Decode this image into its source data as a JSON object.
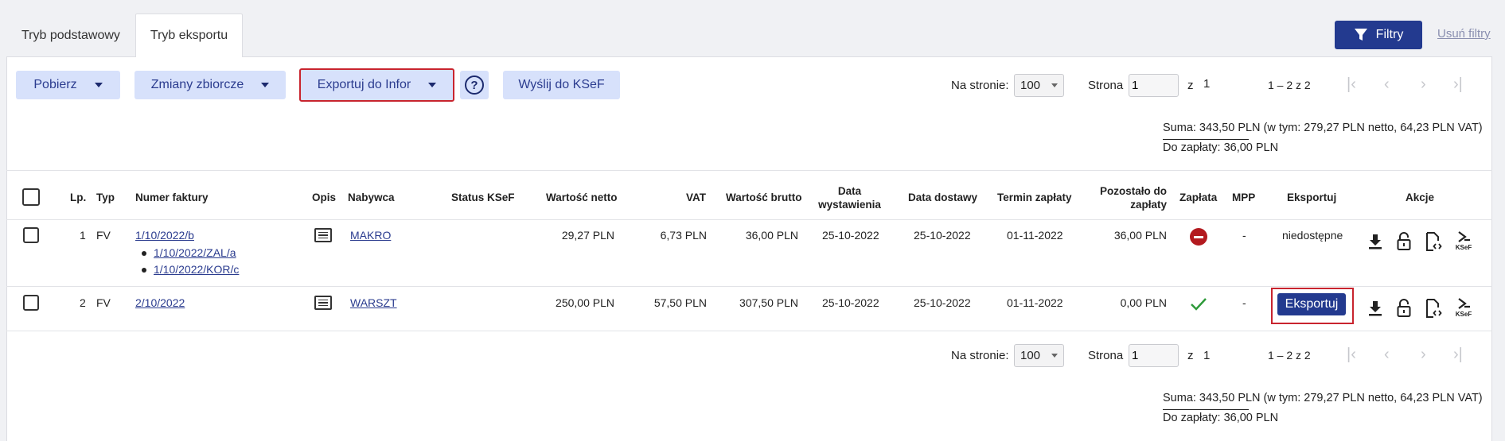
{
  "tabs": [
    {
      "label": "Tryb podstawowy"
    },
    {
      "label": "Tryb eksportu"
    }
  ],
  "filters": {
    "button_label": "Filtry",
    "clear_label": "Usuń filtry"
  },
  "toolbar": {
    "pobierz": "Pobierz",
    "zmiany": "Zmiany zbiorcze",
    "exportuj": "Exportuj do Infor",
    "help": "?",
    "wyslij": "Wyślij do KSeF"
  },
  "pagination": {
    "per_page_label": "Na stronie:",
    "per_page_value": "100",
    "page_label": "Strona",
    "page_value": "1",
    "of_label": "z",
    "total_pages": "1",
    "range": "1 – 2 z 2"
  },
  "summary": {
    "suma": "Suma: 343,50 PLN (w tym: 279,27 PLN netto, 64,23 PLN VAT)",
    "do_zaplaty": "Do zapłaty: 36,00 PLN"
  },
  "columns": {
    "lp": "Lp.",
    "typ": "Typ",
    "numer": "Numer faktury",
    "opis": "Opis",
    "nabywca": "Nabywca",
    "status": "Status KSeF",
    "netto": "Wartość netto",
    "vat": "VAT",
    "brutto": "Wartość brutto",
    "data_wyst": "Data wystawienia",
    "data_dost": "Data dostawy",
    "termin": "Termin zapłaty",
    "pozostalo": "Pozostało do zapłaty",
    "zaplata": "Zapłata",
    "mpp": "MPP",
    "eksportuj": "Eksportuj",
    "akcje": "Akcje"
  },
  "rows": [
    {
      "lp": "1",
      "typ": "FV",
      "numer": "1/10/2022/b",
      "sub": [
        "1/10/2022/ZAL/a",
        "1/10/2022/KOR/c"
      ],
      "nabywca": "MAKRO",
      "netto": "29,27 PLN",
      "vat": "6,73 PLN",
      "brutto": "36,00 PLN",
      "data_wyst": "25-10-2022",
      "data_dost": "25-10-2022",
      "termin": "01-11-2022",
      "pozostalo": "36,00 PLN",
      "zaplata": "unpaid-icon",
      "mpp": "-",
      "eksportuj": "niedostępne"
    },
    {
      "lp": "2",
      "typ": "FV",
      "numer": "2/10/2022",
      "nabywca": "WARSZT",
      "netto": "250,00 PLN",
      "vat": "57,50 PLN",
      "brutto": "307,50 PLN",
      "data_wyst": "25-10-2022",
      "data_dost": "25-10-2022",
      "termin": "01-11-2022",
      "pozostalo": "0,00 PLN",
      "zaplata": "paid-check-icon",
      "mpp": "-",
      "eksportuj": "Eksportuj"
    }
  ],
  "action_icons": [
    "download-icon",
    "unlock-icon",
    "xml-file-icon",
    "ksef-send-icon"
  ],
  "ksef_icon_text": "KSeF",
  "colors": {
    "primary": "#233a8f",
    "button_light": "#d7e1fb",
    "highlight_red": "#c8242e",
    "unpaid": "#b31a1f",
    "paid": "#2e9a3a"
  }
}
